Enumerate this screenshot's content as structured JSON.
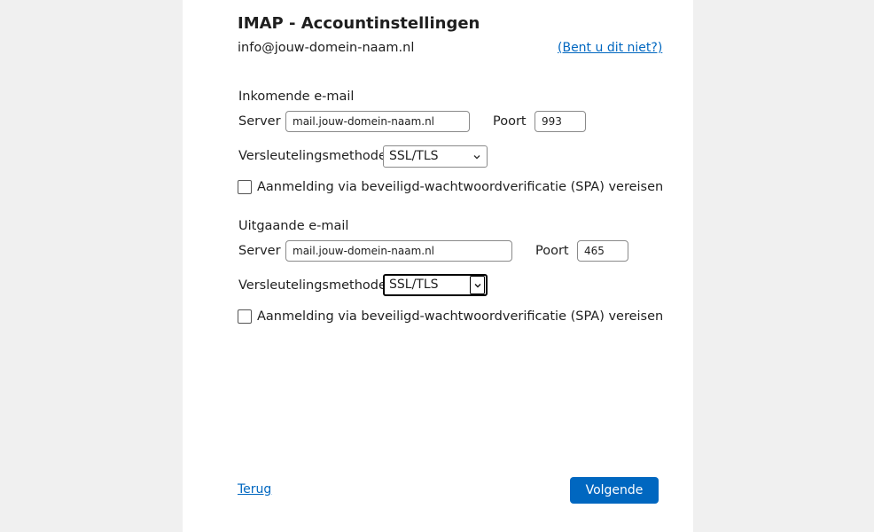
{
  "header": {
    "title": "IMAP - Accountinstellingen",
    "account_email": "info@jouw-domein-naam.nl",
    "not_you_link": "(Bent u dit niet?)"
  },
  "incoming": {
    "section_label": "Inkomende e-mail",
    "server_label": "Server",
    "server_value": "mail.jouw-domein-naam.nl",
    "port_label": "Poort",
    "port_value": "993",
    "encryption_label": "Versleutelingsmethode",
    "encryption_value": "SSL/TLS",
    "spa_label": "Aanmelding via beveiligd-wachtwoordverificatie (SPA) vereisen"
  },
  "outgoing": {
    "section_label": "Uitgaande e-mail",
    "server_label": "Server",
    "server_value": "mail.jouw-domein-naam.nl",
    "port_label": "Poort",
    "port_value": "465",
    "encryption_label": "Versleutelingsmethode",
    "encryption_value": "SSL/TLS",
    "spa_label": "Aanmelding via beveiligd-wachtwoordverificatie (SPA) vereisen"
  },
  "footer": {
    "back_label": "Terug",
    "next_label": "Volgende"
  },
  "colors": {
    "accent": "#0067c0",
    "panel_bg": "#ffffff",
    "page_bg": "#f0f0f0"
  }
}
